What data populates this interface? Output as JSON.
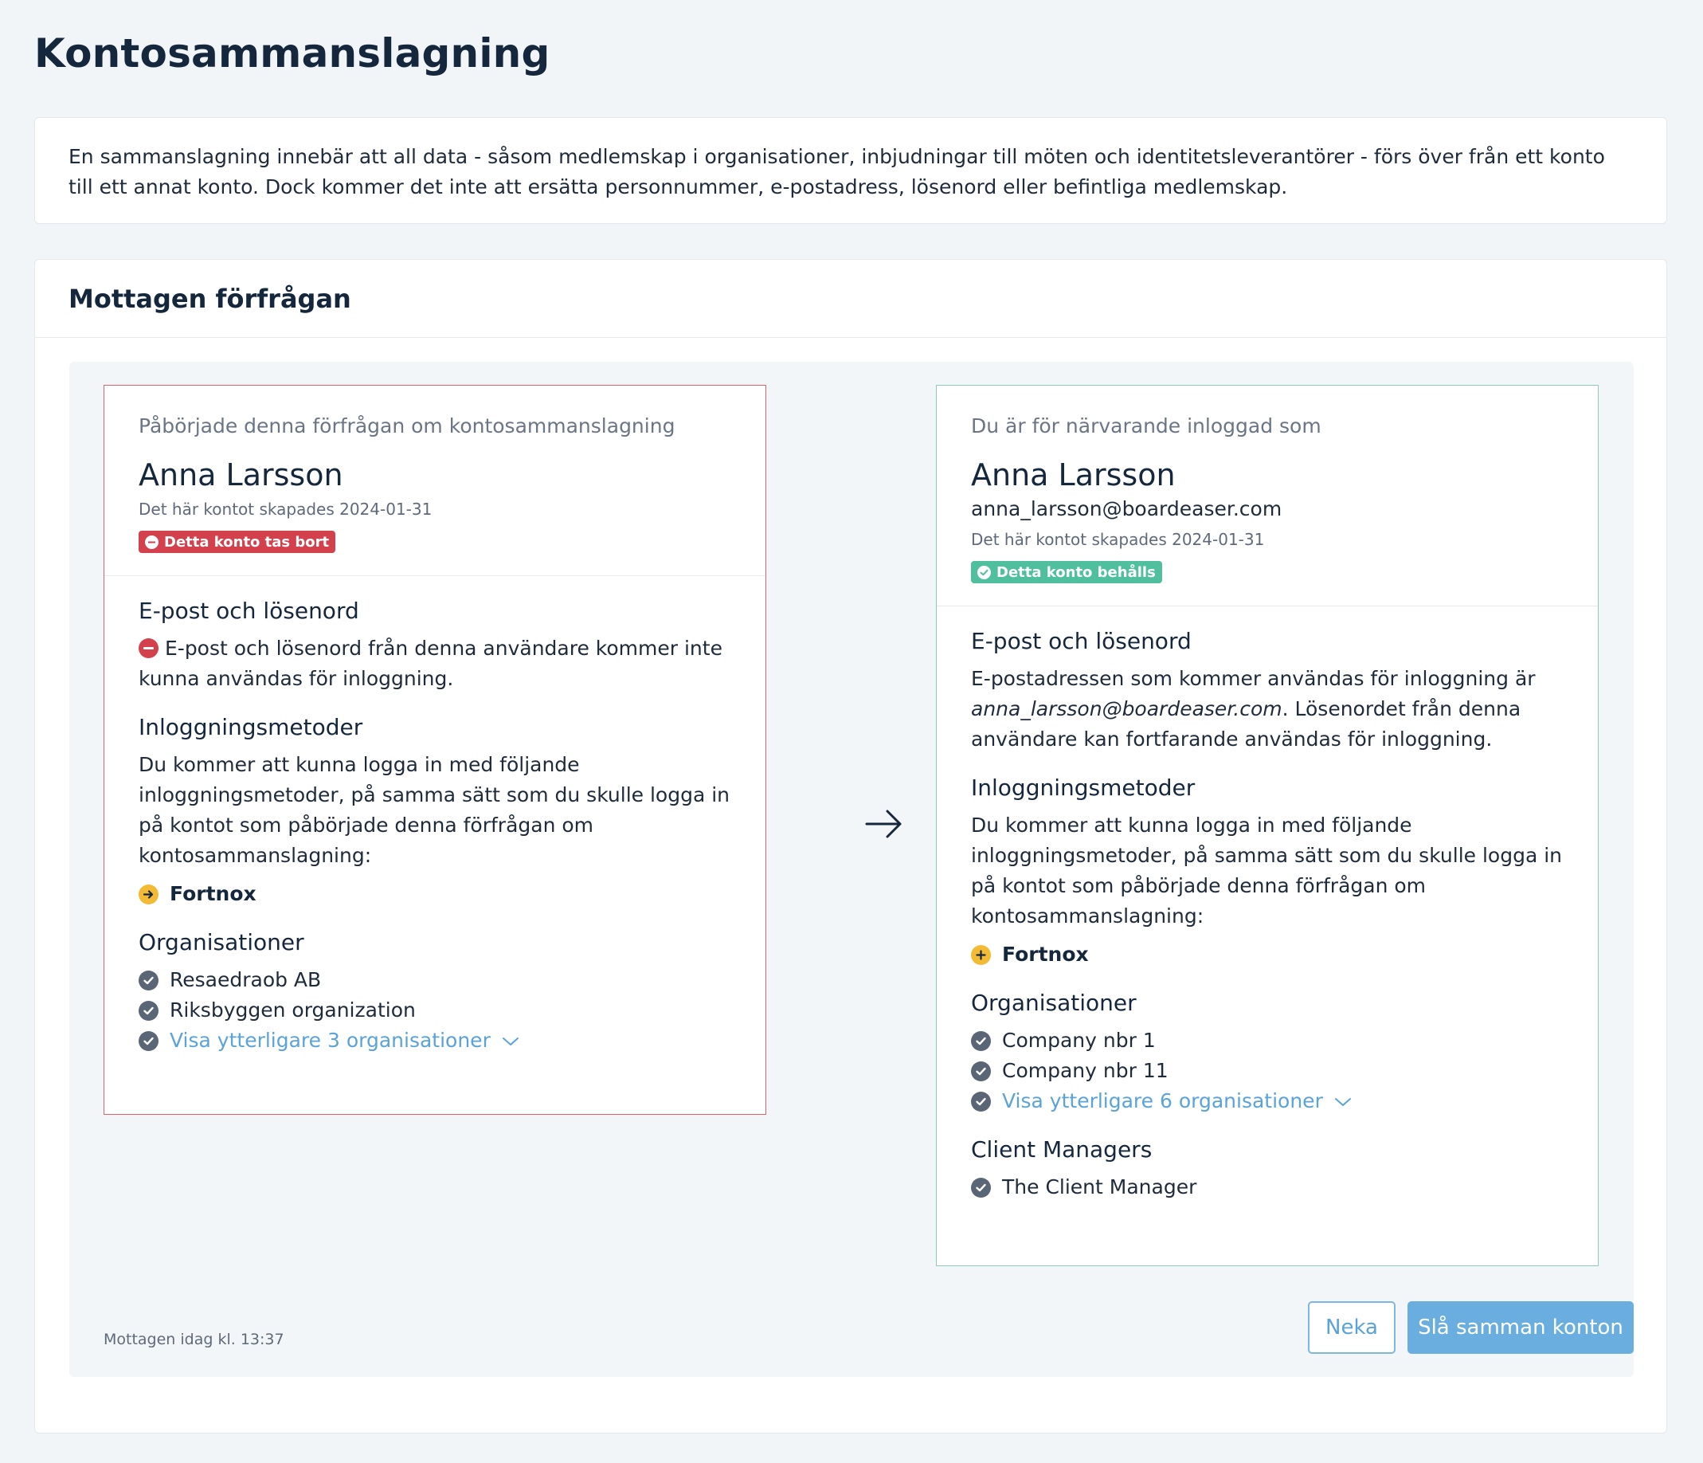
{
  "page": {
    "title": "Kontosammanslagning",
    "intro": "En sammanslagning innebär att all data - såsom medlemskap i organisationer, inbjudningar till möten och identitetsleverantörer - förs över från ett konto till ett annat konto. Dock kommer det inte att ersätta personnummer, e-postadress, lösenord eller befintliga medlemskap."
  },
  "request": {
    "title": "Mottagen förfrågan",
    "received": "Mottagen idag kl. 13:37",
    "deny_label": "Neka",
    "merge_label": "Slå samman konton"
  },
  "left": {
    "caption": "Påbörjade denna förfrågan om kontosammanslagning",
    "name": "Anna Larsson",
    "created": "Det här kontot skapades 2024-01-31",
    "badge": "Detta konto tas bort",
    "email_title": "E-post och lösenord",
    "email_text": "E-post och lösenord från denna användare kommer inte kunna användas för inloggning.",
    "login_title": "Inloggningsmetoder",
    "login_text": "Du kommer att kunna logga in med följande inloggningsmetoder, på samma sätt som du skulle logga in på kontot som påbörjade denna förfrågan om kontosammanslagning:",
    "provider": "Fortnox",
    "orgs_title": "Organisationer",
    "orgs": [
      "Resaedraob AB",
      "Riksbyggen organization"
    ],
    "more_orgs": "Visa ytterligare 3 organisationer"
  },
  "right": {
    "caption": "Du är för närvarande inloggad som",
    "name": "Anna Larsson",
    "email": "anna_larsson@boardeaser.com",
    "created": "Det här kontot skapades 2024-01-31",
    "badge": "Detta konto behålls",
    "email_title": "E-post och lösenord",
    "email_text_before": "E-postadressen som kommer användas för inloggning är",
    "email_text_email": "anna_larsson@boardeaser.com",
    "email_text_after": ". Lösenordet från denna användare kan fortfarande användas för inloggning.",
    "login_title": "Inloggningsmetoder",
    "login_text": "Du kommer att kunna logga in med följande inloggningsmetoder, på samma sätt som du skulle logga in på kontot som påbörjade denna förfrågan om kontosammanslagning:",
    "provider": "Fortnox",
    "orgs_title": "Organisationer",
    "orgs": [
      "Company nbr 1",
      "Company nbr 11"
    ],
    "more_orgs": "Visa ytterligare 6 organisationer",
    "cm_title": "Client Managers",
    "cms": [
      "The Client Manager"
    ]
  },
  "icons": {
    "check": "check-circle-icon",
    "minus": "minus-circle-icon",
    "arrow_provider": "arrow-right-circle-icon",
    "plus_provider": "plus-circle-icon",
    "merge_arrow": "arrow-right-icon",
    "chevron": "chevron-down-icon"
  },
  "colors": {
    "danger": "#d3414d",
    "success": "#4fbf9d",
    "link": "#5aa3d8",
    "primary_button": "#6aaee0",
    "warning_icon": "#f3bb33"
  }
}
